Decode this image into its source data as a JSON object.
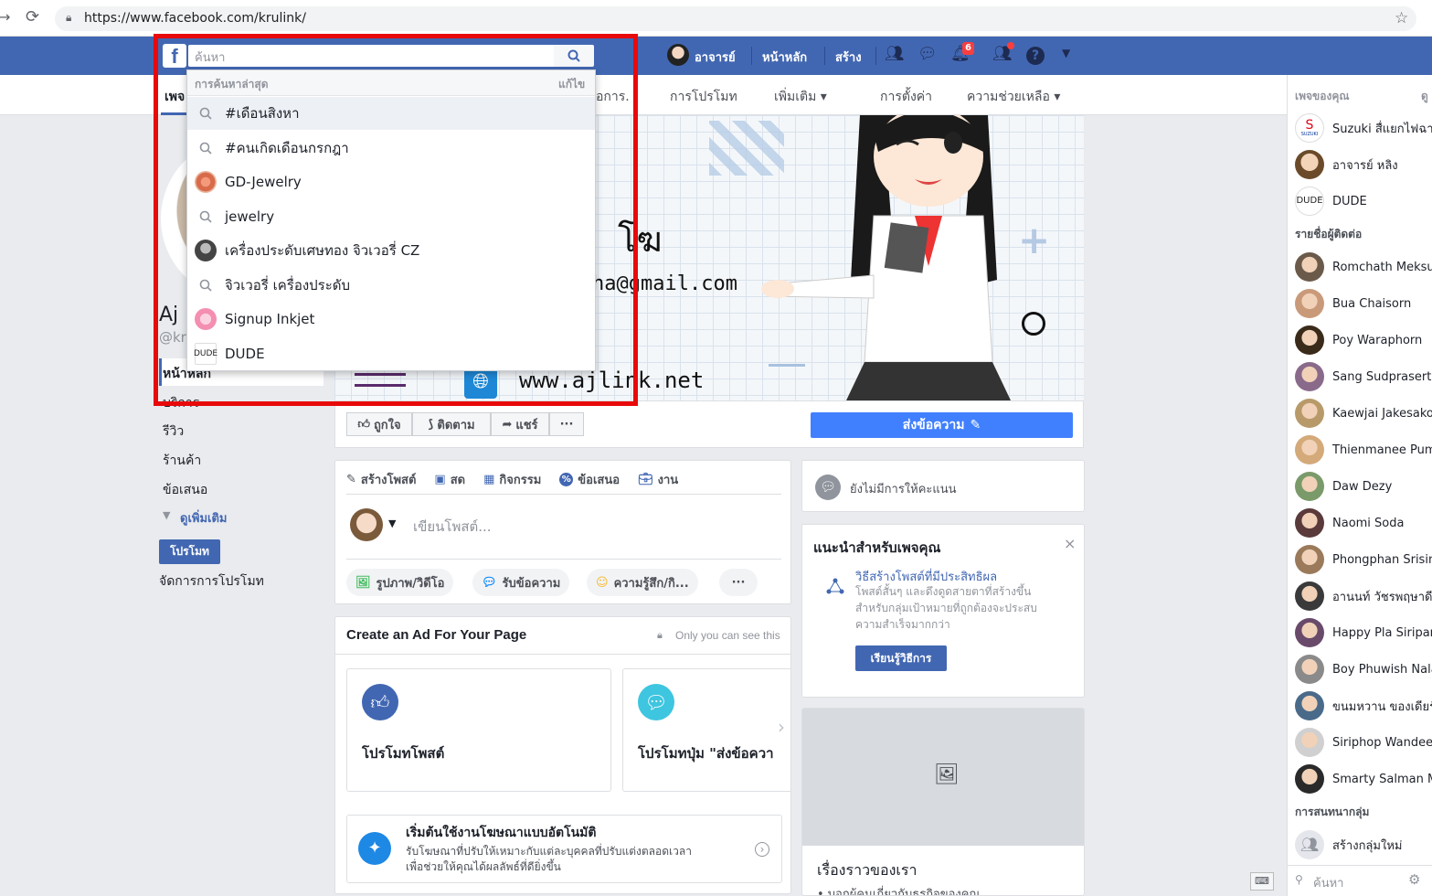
{
  "browser": {
    "url": "https://www.facebook.com/krulink/"
  },
  "topbar": {
    "search_placeholder": "ค้นหา",
    "profile_name": "อาจารย์",
    "home": "หน้าหลัก",
    "create": "สร้าง",
    "notification_count": "6"
  },
  "dropdown": {
    "header": "การค้นหาล่าสุด",
    "edit": "แก้ไข",
    "items": [
      {
        "label": "#เดือนสิงหา",
        "icon": "search-icon"
      },
      {
        "label": "#คนเกิดเดือนกรกฎา",
        "icon": "search-icon"
      },
      {
        "label": "GD-Jewelry",
        "icon": "page-avatar"
      },
      {
        "label": "jewelry",
        "icon": "search-icon"
      },
      {
        "label": "เครื่องประดับเศษทอง จิวเวอรี่ CZ",
        "icon": "page-avatar"
      },
      {
        "label": "จิวเวอรี่ เครื่องประดับ",
        "icon": "search-icon"
      },
      {
        "label": "Signup Inkjet",
        "icon": "page-avatar"
      },
      {
        "label": "DUDE",
        "icon": "dude-logo"
      }
    ],
    "dude_logo_text": "DUDE"
  },
  "page_nav": {
    "first_tab_fragment": "เพจ",
    "partial_tab": "อการ.",
    "tabs": [
      "การโปรโมท",
      "เพิ่มเติม ▾",
      "การตั้งค่า",
      "ความช่วยเหลือ ▾"
    ]
  },
  "left_sidebar": {
    "name_fragment": "Aj L",
    "handle_fragment": "@kr",
    "links": [
      "หน้าหลัก",
      "บริการ",
      "รีวิว",
      "ร้านค้า",
      "ข้อเสนอ"
    ],
    "see_more": "ดูเพิ่มเติม",
    "promote_button": "โปรโมท",
    "manage_promotions": "จัดการการโปรโมท"
  },
  "cover": {
    "title_fragment": "โฆ",
    "email_fragment": "ha@gmail.com",
    "website": "www.ajlink.net"
  },
  "page_actions": {
    "like": "ถูกใจ",
    "follow": "ติดตาม",
    "share": "แชร์",
    "more": "···",
    "send_message": "ส่งข้อความ"
  },
  "composer": {
    "tabs": [
      "สร้างโพสต์",
      "สด",
      "กิจกรรม",
      "ข้อเสนอ",
      "งาน"
    ],
    "placeholder": "เขียนโพสต์...",
    "chips": [
      "รูปภาพ/วิดีโอ",
      "รับข้อความ",
      "ความรู้สึก/กิ..."
    ],
    "more": "···"
  },
  "create_ad": {
    "title": "Create an Ad For Your Page",
    "privacy": "Only you can see this",
    "option1": "โปรโมทโพสต์",
    "option2": "โปรโมทปุ่ม \"ส่งข้อควา",
    "auto_title": "เริ่มต้นใช้งานโฆษณาแบบอัตโนมัติ",
    "auto_desc1": "รับโฆษณาที่ปรับให้เหมาะกับแต่ละบุคคลที่ปรับแต่งตลอดเวลา",
    "auto_desc2": "เพื่อช่วยให้คุณได้ผลลัพธ์ที่ดียิ่งขึ้น"
  },
  "rating": {
    "text": "ยังไม่มีการให้คะแนน"
  },
  "recommend": {
    "title": "แนะนำสำหรับเพจคุณ",
    "close": "×",
    "tip_title": "วิธีสร้างโพสต์ที่มีประสิทธิผล",
    "tip_desc1": "โพสต์สั้นๆ และดึงดูดสายตาที่สร้างขึ้น",
    "tip_desc2": "สำหรับกลุ่มเป้าหมายที่ถูกต้องจะประสบ",
    "tip_desc3": "ความสำเร็จมากกว่า",
    "learn_button": "เรียนรู้วิธีการ"
  },
  "story": {
    "title": "เรื่องราวของเรา",
    "sub_fragment": "• บอกผู้คนเกี่ยวกับธุรกิจของคุณ"
  },
  "right_sidebar": {
    "your_pages": "เพจของคุณ",
    "see_all": "ดู",
    "pages": [
      "Suzuki สื่แยกไฟฉาย",
      "อาจารย์ หลิง",
      "DUDE"
    ],
    "contacts_header": "รายชื่อผู้ติดต่อ",
    "contacts": [
      "Romchath Meksuwan",
      "Bua Chaisorn",
      "Poy Waraphorn",
      "Sang Sudprasert",
      "Kaewjai Jakesakorn",
      "Thienmanee Pum",
      "Daw Dezy",
      "Naomi Soda",
      "Phongphan Srisin",
      "อานนท์ วัชรพฤษาดี",
      "Happy Pla Siripan",
      "Boy Phuwish Nala",
      "ขนมหวาน ของเดียร์",
      "Siriphop Wandee",
      "Smarty Salman M"
    ],
    "group_header": "การสนทนากลุ่ม",
    "create_group": "สร้างกลุ่มใหม่",
    "search_placeholder": "ค้นหา",
    "suzuki_logo_text": "SUZUKI",
    "dude_logo_text": "DUDE"
  },
  "colors": {
    "fb_blue": "#4267b2",
    "highlight_red": "#e8090b",
    "button_blue": "#4080ff"
  }
}
